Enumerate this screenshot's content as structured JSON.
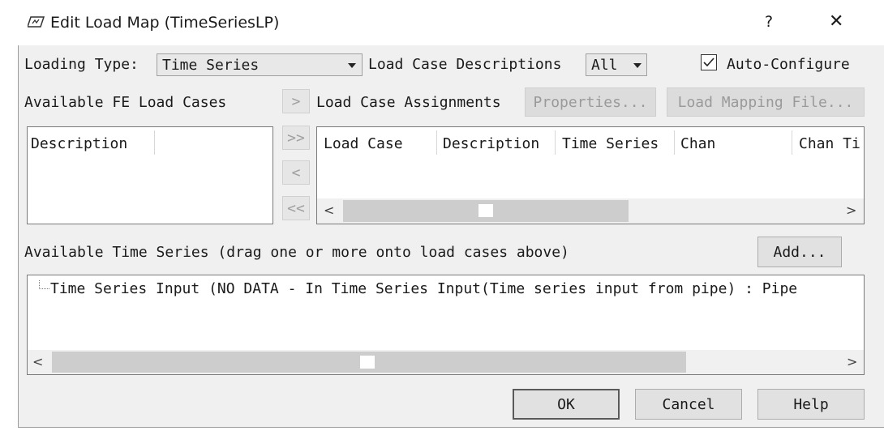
{
  "window": {
    "title": "Edit Load Map (TimeSeriesLP)",
    "help_glyph": "?",
    "close_glyph": "✕"
  },
  "row1": {
    "loading_type_label": "Loading Type:",
    "loading_type_value": "Time Series",
    "desc_label": "Load Case Descriptions",
    "desc_value": "All",
    "auto_configure_label": "Auto-Configure",
    "auto_configure_checked": true
  },
  "row2": {
    "available_fe_label": "Available FE Load Cases",
    "assignments_label": "Load Case Assignments",
    "properties_label": "Properties...",
    "mapping_file_label": "Load Mapping File..."
  },
  "fe_list": {
    "columns": [
      "Description"
    ]
  },
  "move_buttons": {
    "add_one": ">",
    "add_all": ">>",
    "remove_one": "<",
    "remove_all": "<<"
  },
  "assign_table": {
    "columns": [
      "Load Case",
      "Description",
      "Time Series",
      "Chan",
      "Chan Ti"
    ]
  },
  "time_series": {
    "label": "Available Time Series (drag one or more onto load cases above)",
    "add_label": "Add...",
    "tree_item": "Time Series Input (NO DATA - In Time Series Input(Time series input from pipe) : Pipe"
  },
  "footer": {
    "ok": "OK",
    "cancel": "Cancel",
    "help": "Help"
  },
  "scroll": {
    "left": "<",
    "right": ">"
  },
  "colors": {
    "window_bg": "#f0f0f0",
    "titlebar_bg": "#ffffff",
    "border": "#7a7a7a"
  }
}
